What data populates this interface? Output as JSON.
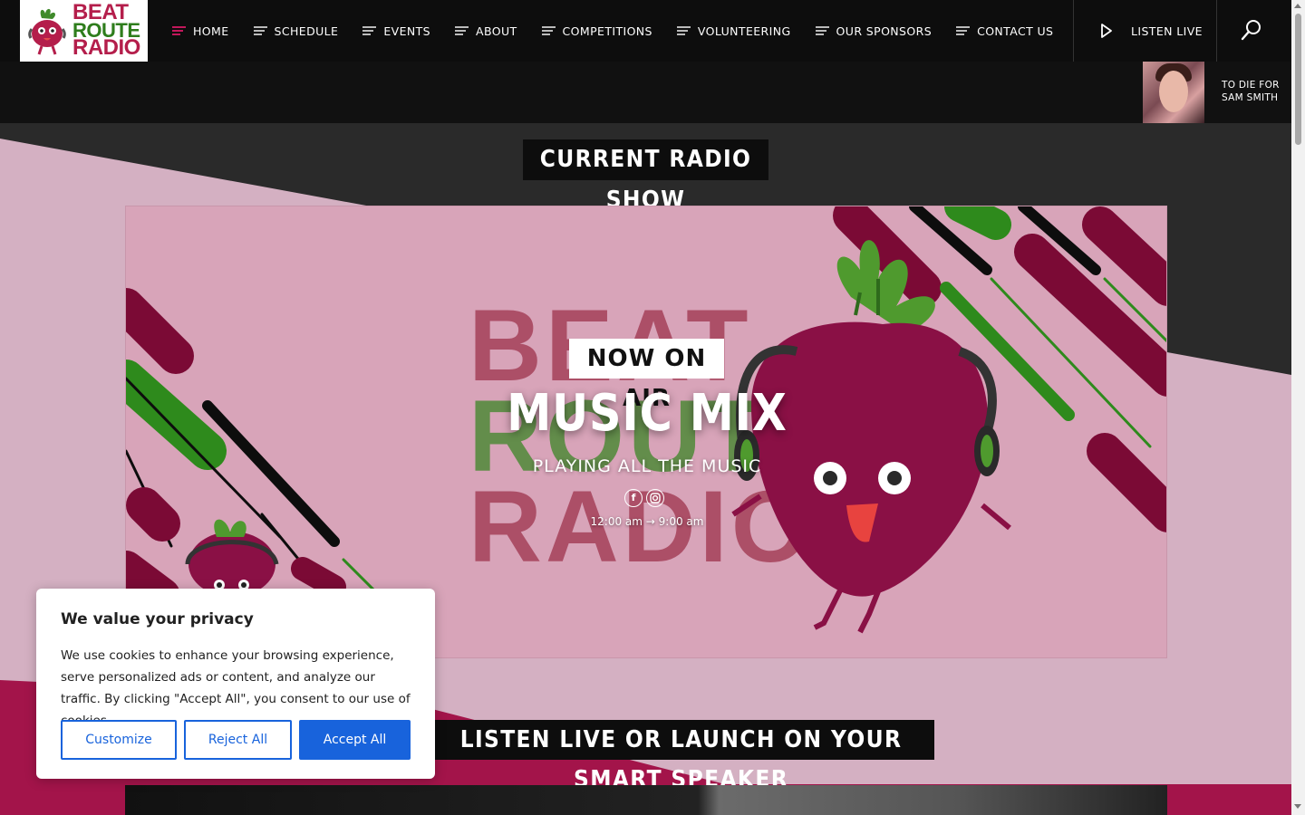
{
  "header": {
    "logo": {
      "line1": "BEAT",
      "line2": "ROUTE",
      "line3": "RADIO"
    },
    "nav": [
      {
        "label": "HOME",
        "name": "home",
        "active": true
      },
      {
        "label": "SCHEDULE",
        "name": "schedule"
      },
      {
        "label": "EVENTS",
        "name": "events"
      },
      {
        "label": "ABOUT",
        "name": "about"
      },
      {
        "label": "COMPETITIONS",
        "name": "competitions"
      },
      {
        "label": "VOLUNTEERING",
        "name": "volunteering"
      },
      {
        "label": "OUR SPONSORS",
        "name": "our-sponsors"
      },
      {
        "label": "CONTACT US",
        "name": "contact-us"
      }
    ],
    "listen_live": "LISTEN LIVE",
    "search_icon": "search-icon",
    "now_playing": {
      "title": "TO DIE FOR",
      "artist": "SAM SMITH"
    }
  },
  "colors": {
    "accent": "#c2185b",
    "dark": "#0d0d0d",
    "pink": "#d4b0c2",
    "button_blue": "#1863dc"
  },
  "current_show": {
    "section_title": "CURRENT RADIO SHOW",
    "badge": "NOW ON AIR",
    "background_words": [
      "BEAT",
      "ROUTE",
      "RADIO"
    ],
    "title": "MUSIC MIX",
    "subtitle": "PLAYING ALL THE MUSIC",
    "socials": [
      "facebook-icon",
      "instagram-icon"
    ],
    "time": "12:00 am → 9:00 am"
  },
  "listen_section": {
    "title": "LISTEN LIVE OR LAUNCH ON YOUR SMART SPEAKER"
  },
  "cookie": {
    "title": "We value your privacy",
    "body": "We use cookies to enhance your browsing experience, serve personalized ads or content, and analyze our traffic. By clicking \"Accept All\", you consent to our use of cookies.",
    "customize": "Customize",
    "reject": "Reject All",
    "accept": "Accept All"
  }
}
